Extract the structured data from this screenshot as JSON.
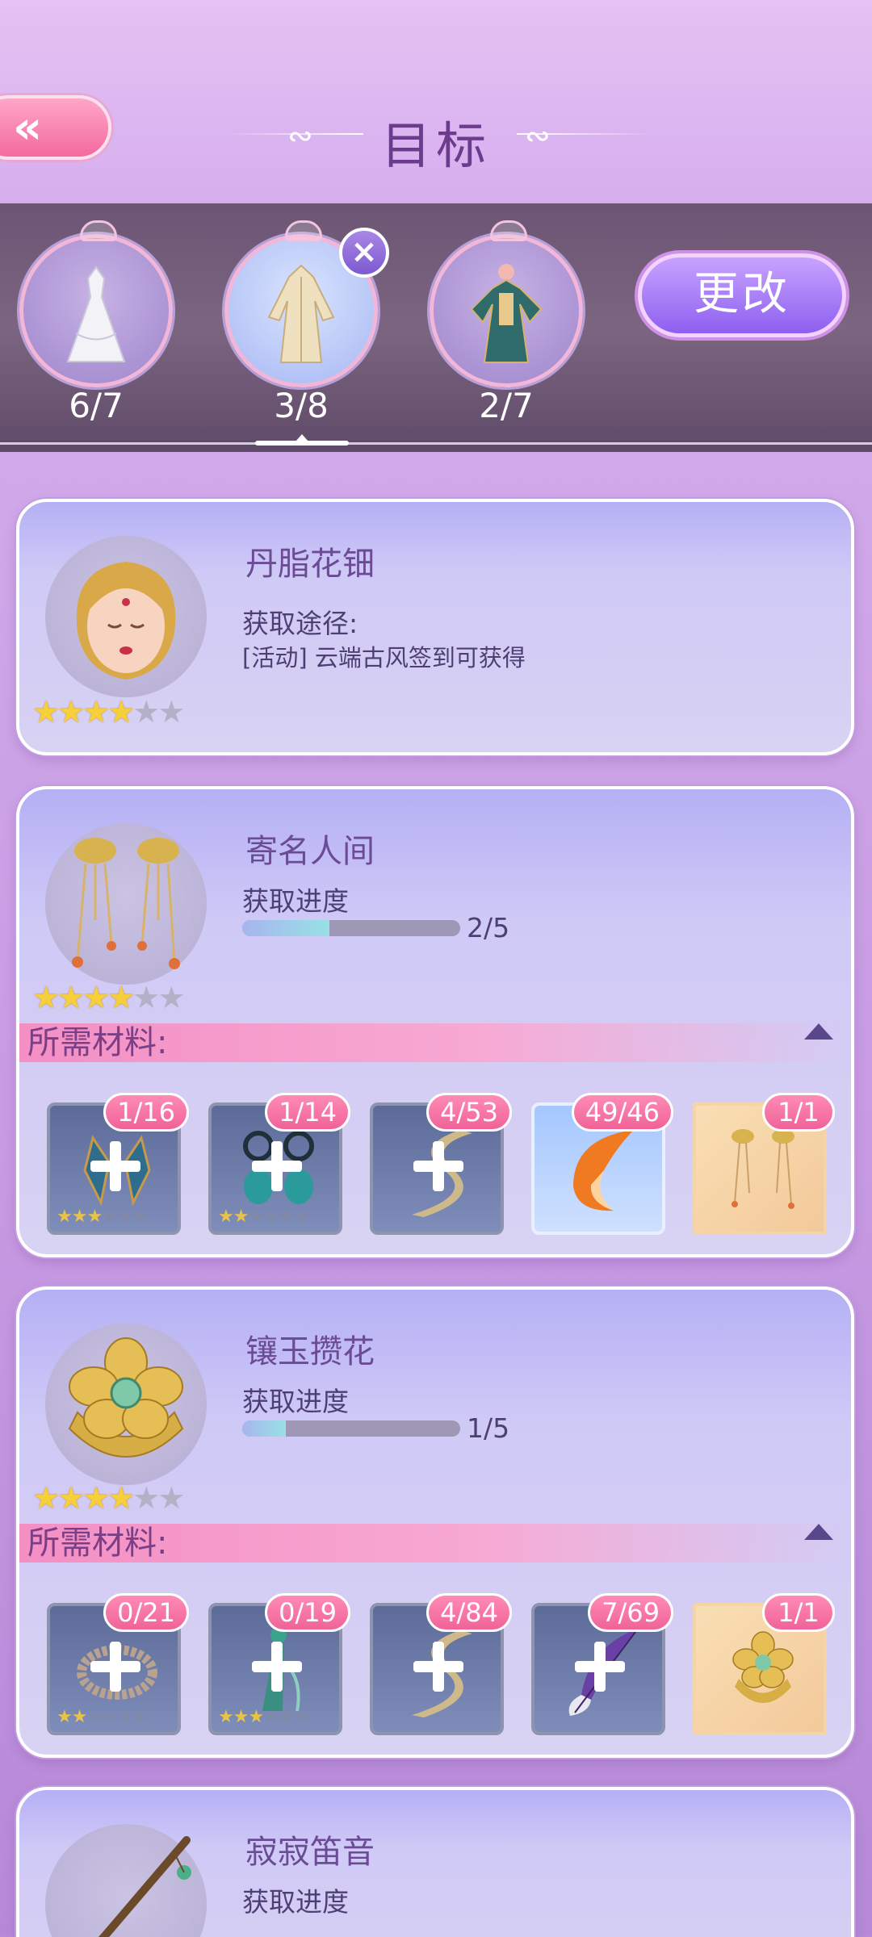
{
  "header": {
    "title": "目标"
  },
  "outfits": [
    {
      "count": "6/7",
      "active": false
    },
    {
      "count": "3/8",
      "active": true
    },
    {
      "count": "2/7",
      "active": false
    }
  ],
  "change_button": "更改",
  "remove_icon": "close-icon",
  "cards": [
    {
      "name": "丹脂花钿",
      "label": "获取途径:",
      "source": "[活动] 云端古风签到可获得",
      "stars": 4,
      "max_stars": 6
    },
    {
      "name": "寄名人间",
      "label": "获取进度",
      "progress": 0.4,
      "progress_text": "2/5",
      "stars": 4,
      "max_stars": 6,
      "materials_label": "所需材料:",
      "materials": [
        {
          "count": "1/16",
          "stars": 3,
          "icon": "blue-earring-icon"
        },
        {
          "count": "1/14",
          "stars": 2,
          "icon": "teal-earring-icon"
        },
        {
          "count": "4/53",
          "icon": "silk-ribbon-icon"
        },
        {
          "count": "49/46",
          "icon": "fox-tail-icon"
        },
        {
          "count": "1/1",
          "icon": "design-scroll-icon"
        }
      ]
    },
    {
      "name": "镶玉攒花",
      "label": "获取进度",
      "progress": 0.2,
      "progress_text": "1/5",
      "stars": 4,
      "max_stars": 6,
      "materials_label": "所需材料:",
      "materials": [
        {
          "count": "0/21",
          "stars": 2,
          "icon": "bead-bracelet-icon"
        },
        {
          "count": "0/19",
          "stars": 3,
          "icon": "jade-hairpin-icon"
        },
        {
          "count": "4/84",
          "icon": "silk-ribbon-icon"
        },
        {
          "count": "7/69",
          "icon": "purple-feather-icon"
        },
        {
          "count": "1/1",
          "icon": "design-scroll-icon"
        }
      ]
    },
    {
      "name": "寂寂笛音",
      "label": "获取进度"
    }
  ],
  "colors": {
    "accent_pink": "#f06398",
    "purple": "#8e5ff0",
    "star": "#f6cf3a"
  }
}
